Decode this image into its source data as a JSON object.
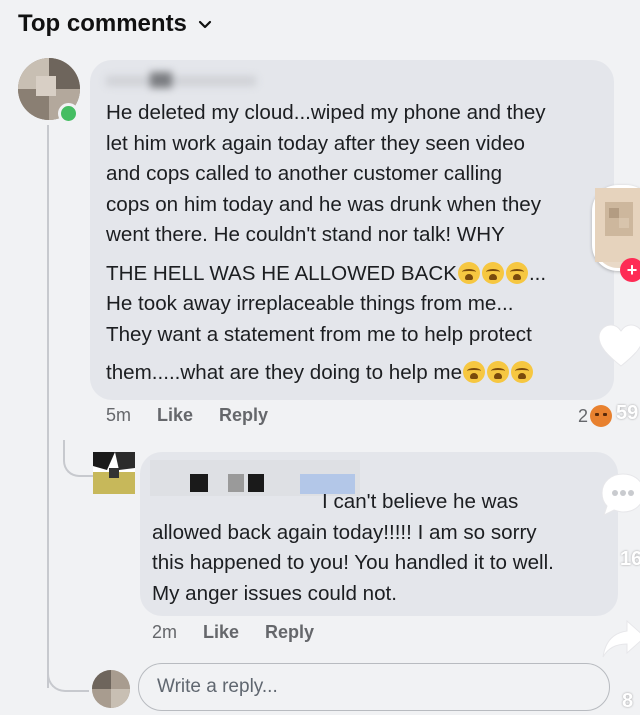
{
  "header": {
    "title": "Top comments"
  },
  "comment": {
    "lines": [
      "He deleted my cloud...wiped my phone and they",
      "let him work again today after they seen video",
      "and cops called to another customer calling",
      "cops on him today and he was drunk when they",
      "went there.  He couldn't stand nor talk! WHY"
    ],
    "line6": "THE HELL WAS HE ALLOWED BACK",
    "line6_tail": "...",
    "lines_b": [
      "He took away irreplaceable things from me...",
      "They want a statement from me to help protect"
    ],
    "line9": "them.....what are they doing to help me",
    "time": "5m",
    "like": "Like",
    "reply": "Reply",
    "reaction_count": "2"
  },
  "reply_comment": {
    "lines": [
      "I can't believe he was",
      "allowed back again today!!!!! I am so sorry",
      "this happened to you! You handled it to well.",
      "My anger issues could not."
    ],
    "time": "2m",
    "like": "Like",
    "reply": "Reply"
  },
  "reply_input": {
    "placeholder": "Write a reply..."
  },
  "side_counts": {
    "likes": "59",
    "comments": "16",
    "shares": "8"
  },
  "icons": {
    "header_chevron": "chevron-down-icon",
    "reaction": "angry-reaction-icon",
    "emoji": "loudly-crying-face-icon",
    "heart": "heart-icon",
    "comments": "comment-icon",
    "share": "share-icon",
    "follow": "plus-icon"
  },
  "colors": {
    "online": "#45bd62",
    "follow": "#fe2c55",
    "bubble": "#e4e6eb"
  }
}
